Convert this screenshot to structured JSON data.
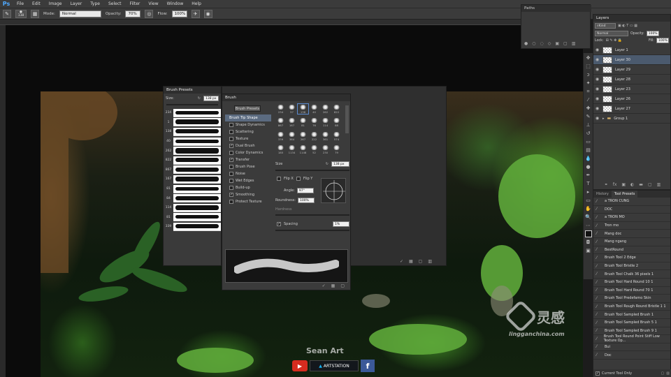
{
  "menubar": {
    "logo": "Ps",
    "items": [
      "File",
      "Edit",
      "Image",
      "Layer",
      "Type",
      "Select",
      "Filter",
      "View",
      "Window",
      "Help"
    ]
  },
  "options": {
    "brush_size": "138",
    "mode_label": "Mode:",
    "mode_value": "Normal",
    "opacity_label": "Opacity:",
    "opacity_value": "70%",
    "flow_label": "Flow:",
    "flow_value": "100%"
  },
  "paths_panel": {
    "title": "Paths"
  },
  "layers_panel": {
    "title": "Layers",
    "kind": "Kind",
    "blend": "Normal",
    "opacity_label": "Opacity:",
    "opacity_value": "100%",
    "lock_label": "Lock:",
    "fill_label": "Fill:",
    "fill_value": "100%",
    "layers": [
      {
        "name": "Layer 1",
        "active": false
      },
      {
        "name": "Layer 30",
        "active": true
      },
      {
        "name": "Layer 29",
        "active": false
      },
      {
        "name": "Layer 28",
        "active": false
      },
      {
        "name": "Layer 23",
        "active": false
      },
      {
        "name": "Layer 26",
        "active": false
      },
      {
        "name": "Layer 27",
        "active": false
      },
      {
        "name": "Group 1",
        "active": false
      }
    ]
  },
  "presets_panel": {
    "tabs": [
      "History",
      "Tool Presets"
    ],
    "items": [
      "a TRON CUNG",
      "DOC",
      "a TRON MO",
      "Tron mo",
      "Mang doc",
      "Mang ngang",
      "BestRound",
      "Brush Tool 2 Edge",
      "Brush Tool Bristle 2",
      "Brush Tool Chalk 36 pixels 1",
      "Brush Tool Hard Round 10 1",
      "Brush Tool Hard Round 70 1",
      "Brush Tool Predefamo Skin",
      "Brush Tool Rough Round Bristle 1 1",
      "Brush Tool Sampled Brush 1",
      "Brush Tool Sampled Brush 5 1",
      "Brush Tool Sampled Brush 9 1",
      "Brush Tool Round Point Stiff Low Texture Op...",
      "Bui",
      "Doc"
    ],
    "footer": "Current Tool Only"
  },
  "brush_presets_panel": {
    "title": "Brush Presets",
    "size_label": "Size:",
    "size_value": "138 px",
    "strokes": [
      "234",
      "1",
      "138",
      "40",
      "262",
      "822",
      "867",
      "167",
      "81",
      "84",
      "114",
      "81",
      "339"
    ]
  },
  "brush_panel": {
    "title": "Brush",
    "presets_button": "Brush Presets",
    "options": [
      {
        "label": "Brush Tip Shape",
        "checked": null,
        "selected": true
      },
      {
        "label": "Shape Dynamics",
        "checked": false
      },
      {
        "label": "Scattering",
        "checked": false
      },
      {
        "label": "Texture",
        "checked": false
      },
      {
        "label": "Dual Brush",
        "checked": true
      },
      {
        "label": "Color Dynamics",
        "checked": false
      },
      {
        "label": "Transfer",
        "checked": true
      },
      {
        "label": "Brush Pose",
        "checked": false
      },
      {
        "label": "Noise",
        "checked": false
      },
      {
        "label": "Wet Edges",
        "checked": false
      },
      {
        "label": "Build-up",
        "checked": false
      },
      {
        "label": "Smoothing",
        "checked": true
      },
      {
        "label": "Protect Texture",
        "checked": false
      }
    ],
    "tips": [
      "234",
      "57",
      "138",
      "40",
      "262",
      "822",
      "867",
      "167",
      "81",
      "76",
      "114",
      "88",
      "339",
      "364",
      "267",
      "222",
      "361",
      "574",
      "185",
      "1134",
      "1148",
      "52",
      "230",
      "79"
    ],
    "size_label": "Size",
    "size_value": "138 px",
    "flip_x": "Flip X",
    "flip_y": "Flip Y",
    "angle_label": "Angle:",
    "angle_value": "97°",
    "roundness_label": "Roundness:",
    "roundness_value": "100%",
    "hardness_label": "Hardness",
    "spacing_label": "Spacing",
    "spacing_value": "1%"
  },
  "branding": {
    "wm_brand": "灵感",
    "wm_url": "lingganchina.com",
    "channel_name": "Sean Art",
    "artstation": "ARTSTATION"
  },
  "colors": {
    "accent": "#4fa9ff",
    "selection": "#4b5a6e",
    "youtube": "#d62c1f",
    "facebook": "#3b5998"
  }
}
